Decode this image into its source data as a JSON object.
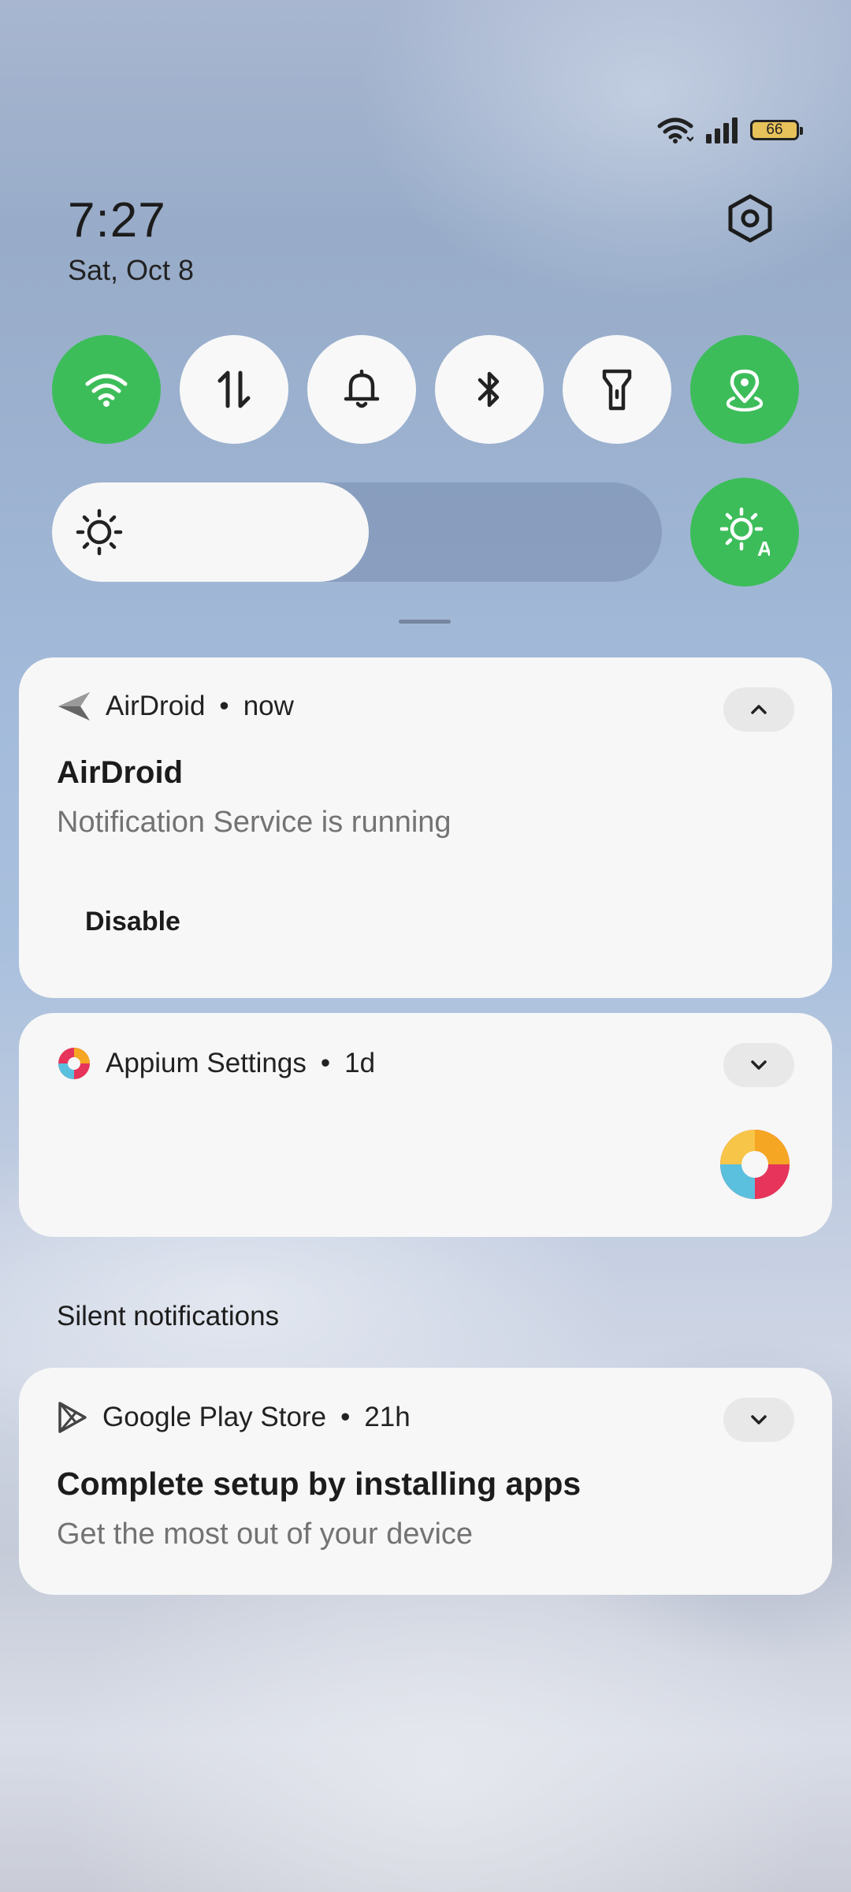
{
  "status_bar": {
    "icons": [
      "wifi-icon",
      "cellular-signal-icon",
      "battery-icon"
    ],
    "battery_level": "66"
  },
  "header": {
    "time": "7:27",
    "date": "Sat, Oct 8",
    "settings_icon": "settings-hexagon-icon"
  },
  "quick_settings": {
    "tiles": [
      {
        "name": "wifi",
        "icon": "wifi-icon",
        "state": "on"
      },
      {
        "name": "mobile-data",
        "icon": "data-arrows-icon",
        "state": "off"
      },
      {
        "name": "ring",
        "icon": "bell-icon",
        "state": "off"
      },
      {
        "name": "bluetooth",
        "icon": "bluetooth-icon",
        "state": "off"
      },
      {
        "name": "flashlight",
        "icon": "flashlight-icon",
        "state": "off"
      },
      {
        "name": "location",
        "icon": "location-pin-icon",
        "state": "on"
      }
    ],
    "brightness_level": 0.52,
    "auto_brightness": "on"
  },
  "notifications": [
    {
      "app": "AirDroid",
      "time": "now",
      "title": "AirDroid",
      "text": "Notification Service is running",
      "action": "Disable",
      "expanded": true
    },
    {
      "app": "Appium Settings",
      "time": "1d",
      "expanded": false
    }
  ],
  "silent_section": {
    "label": "Silent notifications",
    "items": [
      {
        "app": "Google Play Store",
        "time": "21h",
        "title": "Complete setup by installing apps",
        "text": "Get the most out of your device",
        "expanded": false
      }
    ]
  },
  "colors": {
    "accent_green": "#3dbd5a",
    "card_bg": "#f7f7f7",
    "tile_off": "#f8f8f8"
  }
}
